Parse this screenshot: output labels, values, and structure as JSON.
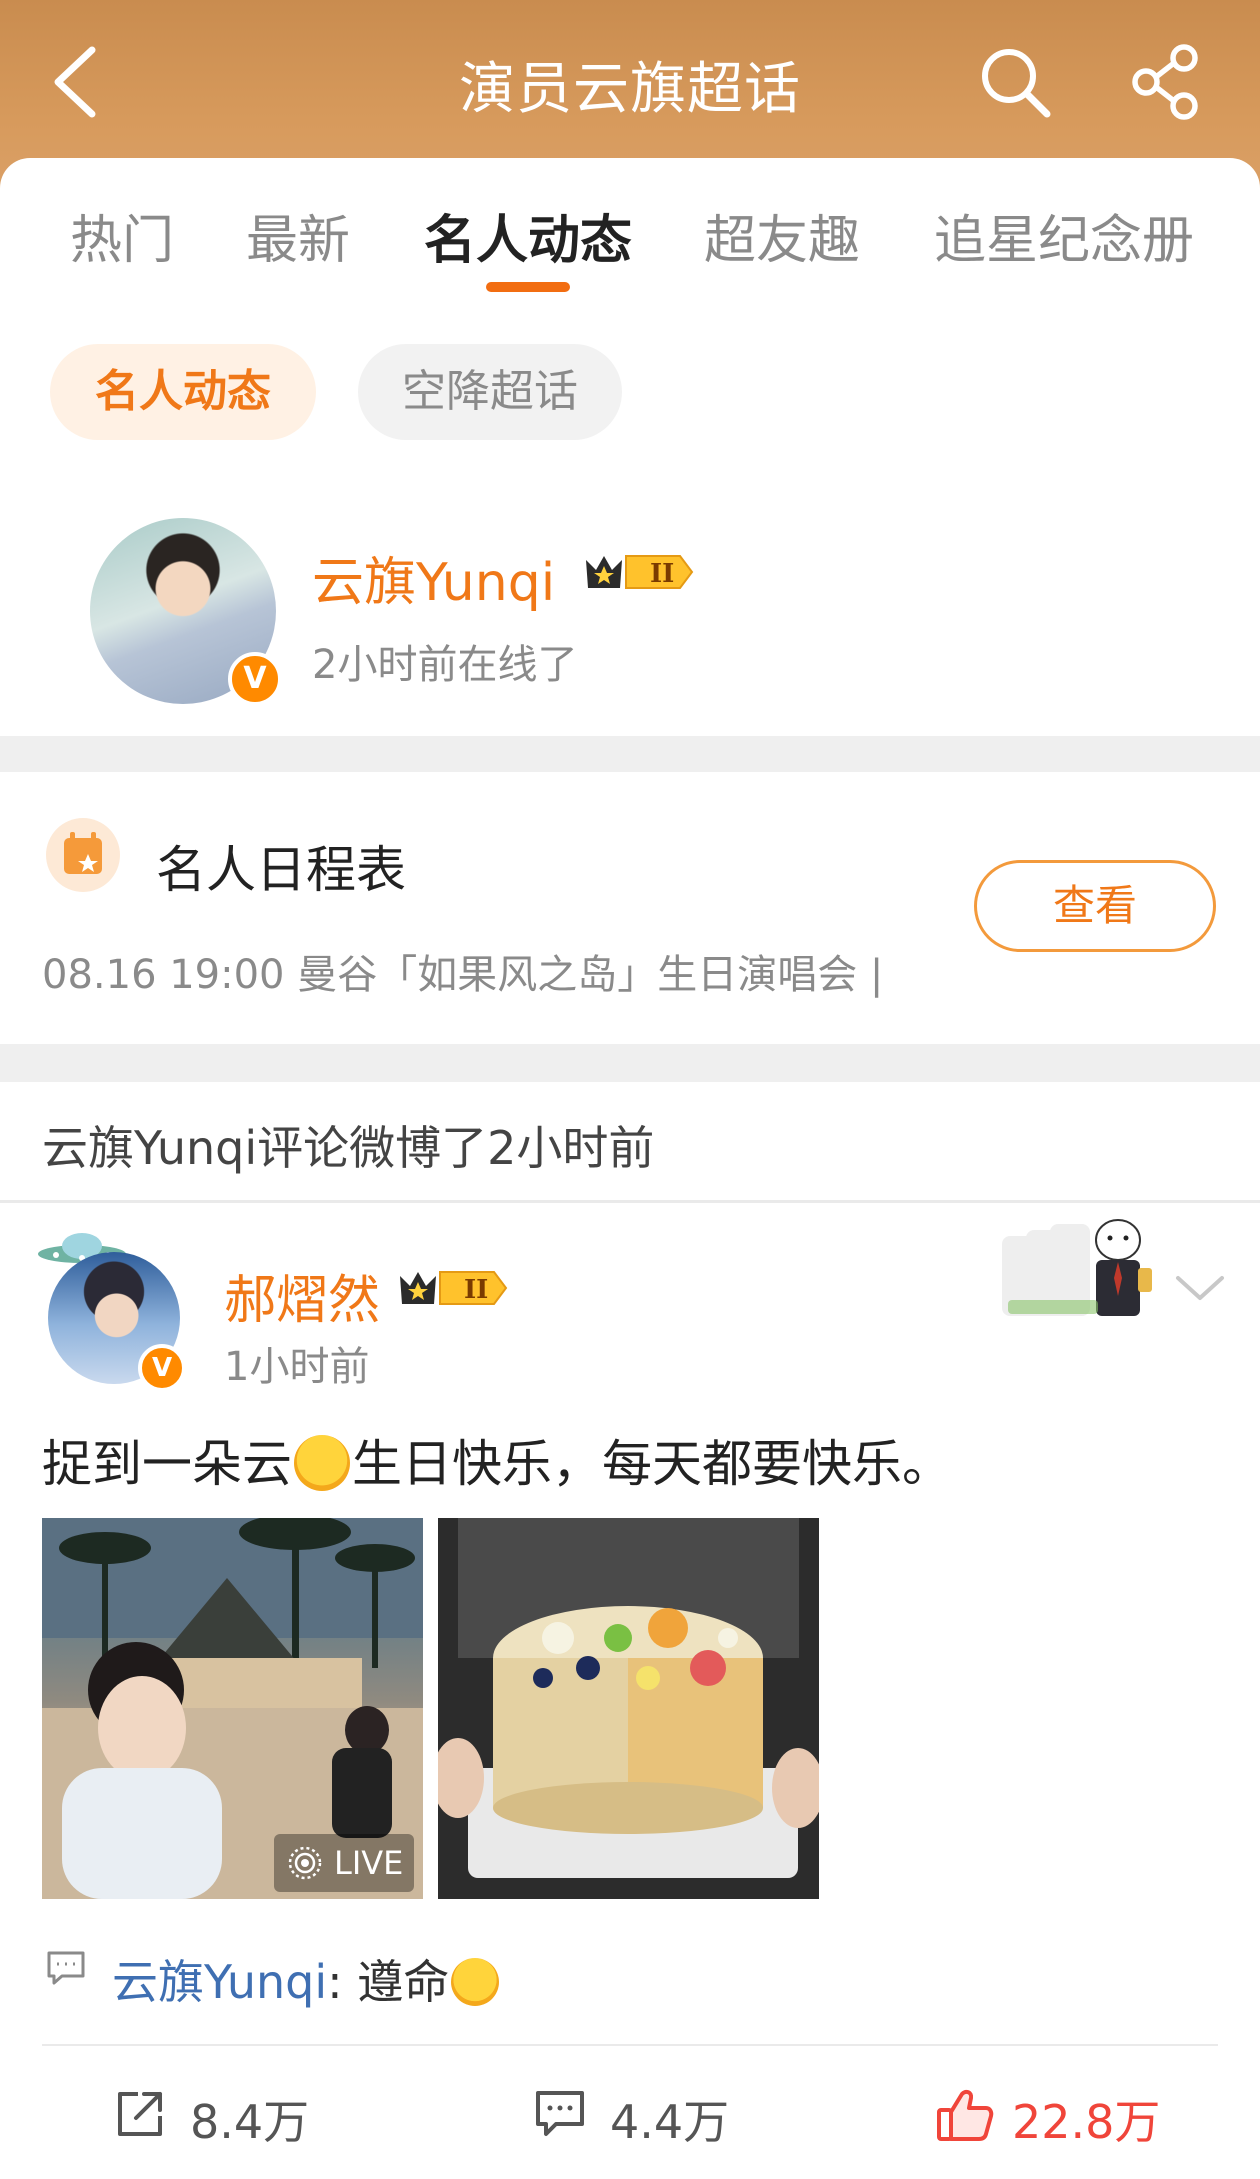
{
  "header": {
    "title": "演员云旗超话",
    "gradient_color": "#d79a5c"
  },
  "tabs": [
    {
      "label": "热门"
    },
    {
      "label": "最新"
    },
    {
      "label": "名人动态",
      "active": true
    },
    {
      "label": "超友趣"
    },
    {
      "label": "追星纪念册"
    }
  ],
  "chips": [
    {
      "label": "名人动态",
      "active": true
    },
    {
      "label": "空降超话"
    }
  ],
  "celebrity": {
    "name": "云旗Yunqi",
    "status": "2小时前在线了",
    "badge_level": "II",
    "verified": "V"
  },
  "schedule": {
    "title": "名人日程表",
    "info": "08.16 19:00 曼谷「如果风之岛」生日演唱会 |",
    "button": "查看"
  },
  "activity": {
    "text": "云旗Yunqi评论微博了2小时前"
  },
  "post": {
    "author": "郝熠然",
    "badge_level": "II",
    "verified": "V",
    "time": "1小时前",
    "text_part1": "捉到一朵云",
    "text_part2": "生日快乐，每天都要快乐。",
    "image1_badge": "LIVE",
    "comment_author": "云旗Yunqi",
    "comment_sep": ": ",
    "comment_text": "遵命"
  },
  "actions": {
    "repost": "8.4万",
    "comment": "4.4万",
    "like": "22.8万"
  },
  "colors": {
    "accent": "#f07818",
    "like": "#f0453a",
    "link": "#3f6fb2"
  }
}
